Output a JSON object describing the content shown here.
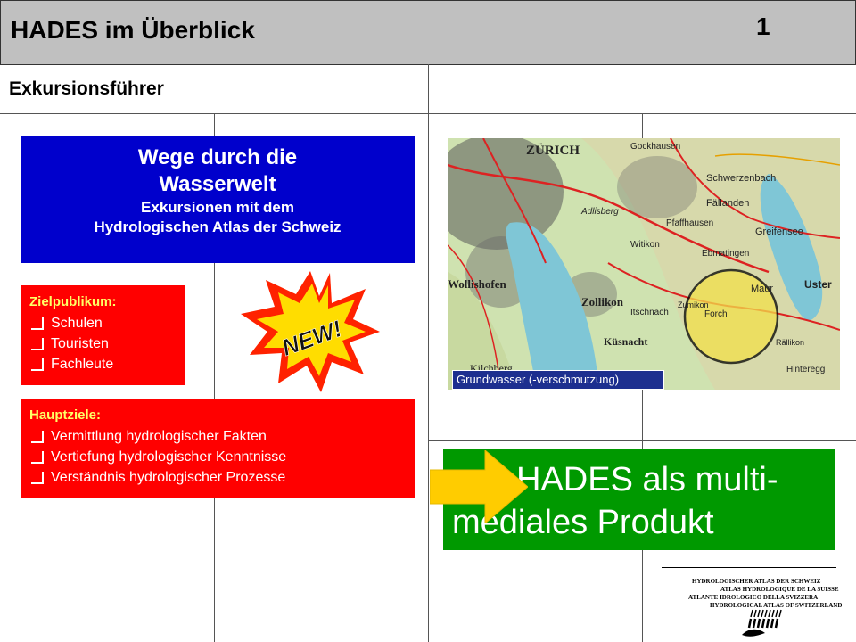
{
  "header": {
    "title": "HADES im Überblick",
    "page_number": "1"
  },
  "subtitle": "Exkursionsführer",
  "blue_box": {
    "line1": "Wege durch die",
    "line2": "Wasserwelt",
    "line3": "Exkursionen mit dem",
    "line4": "Hydrologischen Atlas der Schweiz"
  },
  "audience": {
    "heading": "Zielpublikum:",
    "items": [
      "Schulen",
      "Touristen",
      "Fachleute"
    ]
  },
  "goals": {
    "heading": "Hauptziele:",
    "items": [
      "Vermittlung hydrologischer Fakten",
      "Vertiefung hydrologischer Kenntnisse",
      "Verständnis hydrologischer Prozesse"
    ]
  },
  "badge": {
    "text": "NEW!"
  },
  "map": {
    "caption": "Grundwasser (-verschmutzung)",
    "labels": [
      "ZÜRICH",
      "Gockhausen",
      "Schwerzenbach",
      "Fällanden",
      "Greifensee",
      "Wollishofen",
      "Zollikon",
      "Maur",
      "Forch",
      "Küsnacht",
      "Kilchberg",
      "Itschnach",
      "Uster",
      "Witikon",
      "Ebmatingen",
      "Pfaffhausen",
      "Adlisberg",
      "Zumikon",
      "Hinteregg",
      "Rällikon"
    ]
  },
  "green_box": {
    "line1": "HADES als multi-",
    "line2": "mediales Produkt"
  },
  "logo": {
    "lines": [
      "HYDROLOGISCHER ATLAS DER SCHWEIZ",
      "ATLAS HYDROLOGIQUE DE LA SUISSE",
      "ATLANTE IDROLOGICO DELLA SVIZZERA",
      "HYDROLOGICAL ATLAS OF SWITZERLAND"
    ]
  },
  "colors": {
    "header_bg": "#c0c0c0",
    "blue_box": "#0000cc",
    "red_box": "#ff0000",
    "green_box": "#009900",
    "arrow": "#ffcc00",
    "badge_burst": "#ff2200",
    "badge_inner": "#ffdd00"
  }
}
